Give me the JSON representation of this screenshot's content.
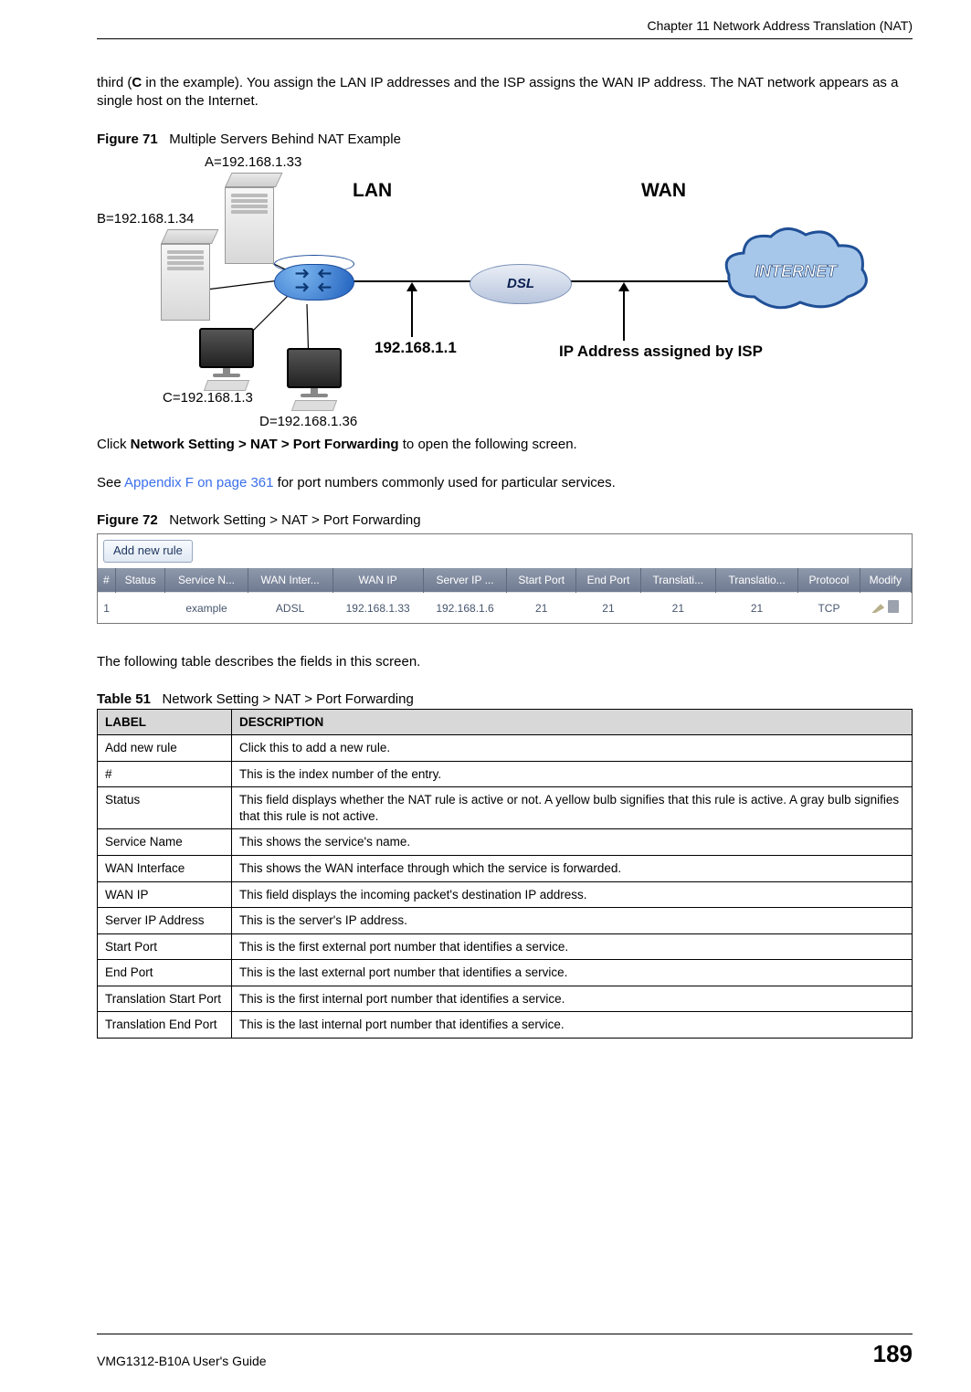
{
  "header": {
    "chapter": "Chapter 11 Network Address Translation (NAT)"
  },
  "intro": {
    "para1_pre": "third (",
    "para1_bold": "C",
    "para1_post": " in the example). You assign the LAN IP addresses and the ISP assigns the WAN IP address. The NAT network appears as a single host on the Internet."
  },
  "fig71": {
    "label": "Figure 71",
    "title": "Multiple Servers Behind NAT Example",
    "lan": "LAN",
    "wan": "WAN",
    "a": "A=192.168.1.33",
    "b": "B=192.168.1.34",
    "c": "C=192.168.1.3",
    "d": "D=192.168.1.36",
    "gw": "192.168.1.1",
    "isp": "IP Address assigned by ISP",
    "internet": "INTERNET",
    "dsl": "DSL"
  },
  "mid": {
    "click_pre": "Click ",
    "click_bold": "Network Setting > NAT > Port Forwarding",
    "click_post": " to open the following screen.",
    "see_pre": "See ",
    "see_link": "Appendix F on page 361",
    "see_post": " for port numbers commonly used for particular services."
  },
  "fig72": {
    "label": "Figure 72",
    "title": "Network Setting > NAT > Port Forwarding",
    "add_rule": "Add new rule",
    "cols": {
      "num": "#",
      "status": "Status",
      "service": "Service N...",
      "wanif": "WAN Inter...",
      "wanip": "WAN IP",
      "serverip": "Server IP ...",
      "sport": "Start Port",
      "eport": "End Port",
      "t1": "Translati...",
      "t2": "Translatio...",
      "proto": "Protocol",
      "modify": "Modify"
    },
    "row": {
      "num": "1",
      "status": "",
      "service": "example",
      "wanif": "ADSL",
      "wanip": "192.168.1.33",
      "serverip": "192.168.1.6",
      "sport": "21",
      "eport": "21",
      "t1": "21",
      "t2": "21",
      "proto": "TCP"
    }
  },
  "table_intro": "The following table describes the fields in this screen.",
  "table51": {
    "label": "Table 51",
    "title": "Network Setting > NAT > Port Forwarding",
    "head_label": "LABEL",
    "head_desc": "DESCRIPTION",
    "rows": [
      {
        "label": "Add new rule",
        "desc": "Click this to add a new rule."
      },
      {
        "label": "#",
        "desc": "This is the index number of the entry."
      },
      {
        "label": "Status",
        "desc": "This field displays whether the NAT rule is active or not. A yellow bulb signifies that this rule is active. A gray bulb signifies that this rule is not active."
      },
      {
        "label": "Service Name",
        "desc": "This shows the service's name."
      },
      {
        "label": "WAN Interface",
        "desc": "This shows the WAN interface through which the service is forwarded."
      },
      {
        "label": "WAN IP",
        "desc": "This field displays the incoming packet's destination IP address."
      },
      {
        "label": "Server IP Address",
        "desc": "This is the server's IP address."
      },
      {
        "label": "Start Port",
        "desc": "This is the first external port number that identifies a service."
      },
      {
        "label": "End Port",
        "desc": "This is the last external port number that identifies a service."
      },
      {
        "label": "Translation Start Port",
        "desc": "This is the first internal port number that identifies a service."
      },
      {
        "label": "Translation End Port",
        "desc": "This is the last internal port number that identifies a service."
      }
    ]
  },
  "footer": {
    "guide": "VMG1312-B10A User's Guide",
    "page": "189"
  }
}
